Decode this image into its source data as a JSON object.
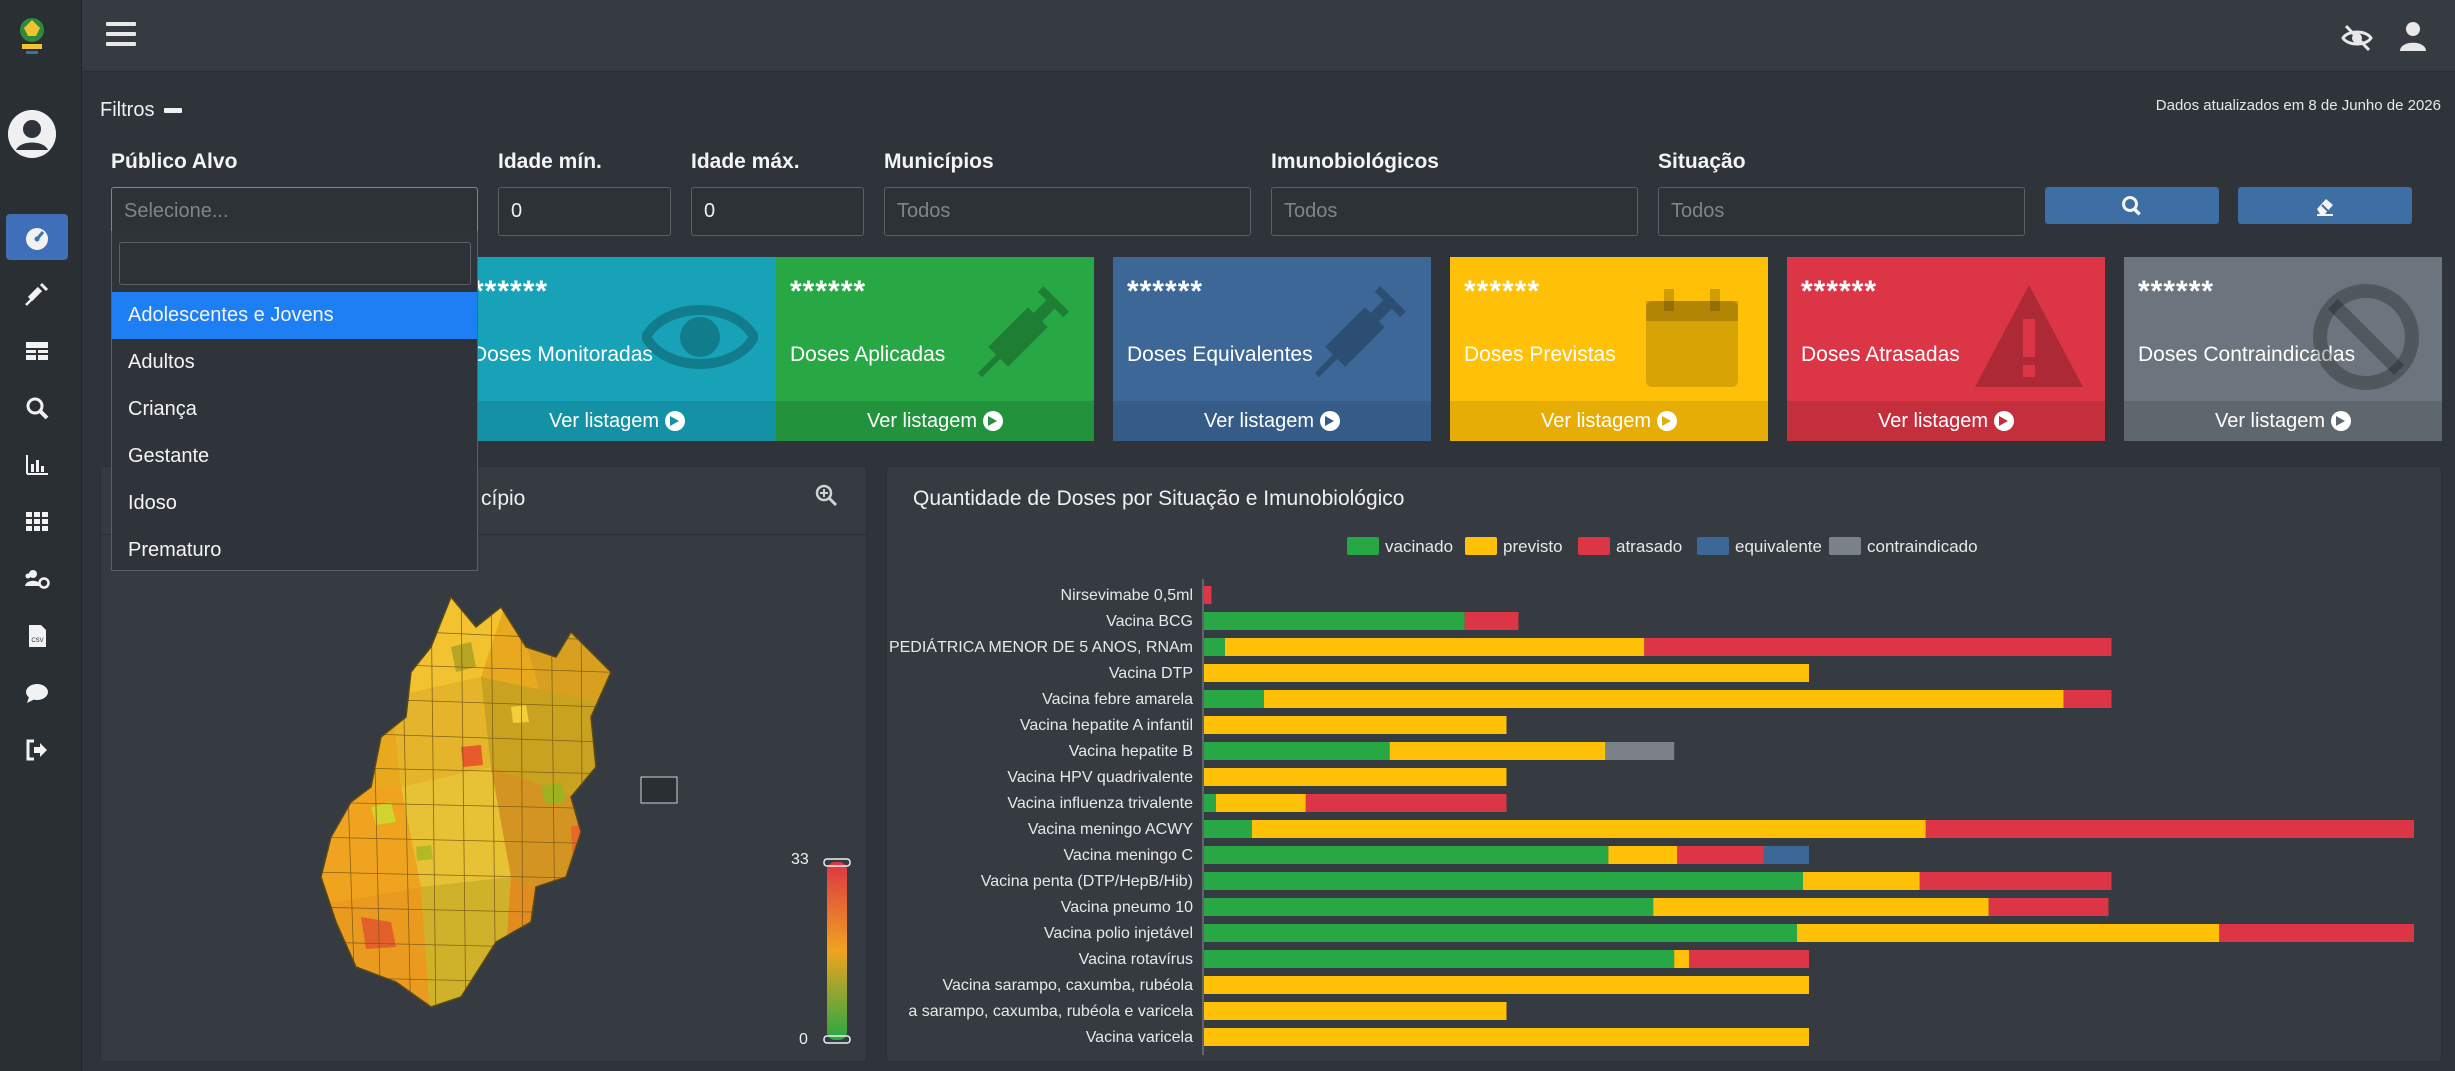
{
  "header": {
    "menu_icon": "hamburger-icon",
    "right_icons": [
      "eye-slash-icon",
      "user-icon"
    ]
  },
  "sidebar": {
    "items": [
      {
        "icon": "dashboard-icon",
        "active": true
      },
      {
        "icon": "syringe-icon"
      },
      {
        "icon": "table-icon"
      },
      {
        "icon": "search-icon"
      },
      {
        "icon": "bar-chart-icon"
      },
      {
        "icon": "grid-icon"
      },
      {
        "icon": "users-cog-icon"
      },
      {
        "icon": "csv-file-icon"
      },
      {
        "icon": "comment-icon"
      },
      {
        "icon": "sign-out-icon"
      }
    ]
  },
  "filters": {
    "title": "Filtros",
    "updated": "Dados atualizados em 8 de Junho de 2026",
    "publico_alvo": {
      "label": "Público Alvo",
      "placeholder": "Selecione..."
    },
    "idade_min": {
      "label": "Idade mín.",
      "value": "0"
    },
    "idade_max": {
      "label": "Idade máx.",
      "value": "0"
    },
    "municipios": {
      "label": "Municípios",
      "placeholder": "Todos"
    },
    "imunobiologicos": {
      "label": "Imunobiológicos",
      "placeholder": "Todos"
    },
    "situacao": {
      "label": "Situação",
      "placeholder": "Todos"
    },
    "search_button_icon": "search-icon",
    "clear_button_icon": "eraser-icon"
  },
  "dropdown": {
    "options": [
      "Adolescentes e Jovens",
      "Adultos",
      "Criança",
      "Gestante",
      "Idoso",
      "Prematuro"
    ],
    "highlighted": "Adolescentes e Jovens"
  },
  "cards": [
    {
      "value": "******",
      "label": "Doses Monitoradas",
      "link": "Ver listagem",
      "icon": "eye-icon",
      "color": "#17a2b8",
      "foot": "#1591a5"
    },
    {
      "value": "******",
      "label": "Doses Aplicadas",
      "link": "Ver listagem",
      "icon": "syringe-icon",
      "color": "#28a745",
      "foot": "#22923c"
    },
    {
      "value": "******",
      "label": "Doses Equivalentes",
      "link": "Ver listagem",
      "icon": "syringe-icon",
      "color": "#3c6797",
      "foot": "#355b87"
    },
    {
      "value": "******",
      "label": "Doses Previstas",
      "link": "Ver listagem",
      "icon": "calendar-icon",
      "color": "#ffc107",
      "foot": "#e6ad06"
    },
    {
      "value": "******",
      "label": "Doses Atrasadas",
      "link": "Ver listagem",
      "icon": "warning-icon",
      "color": "#dc3545",
      "foot": "#c42f3d"
    },
    {
      "value": "******",
      "label": "Doses Contraindicadas",
      "link": "Ver listagem",
      "icon": "ban-icon",
      "color": "#6c757d",
      "foot": "#5f676e"
    }
  ],
  "map_panel": {
    "title": "cípio",
    "zoom_icon": "zoom-in-icon",
    "scale_max": "33",
    "scale_min": "0"
  },
  "chart_panel": {
    "title": "Quantidade de Doses por Situação e Imunobiológico"
  },
  "chart_data": {
    "type": "bar",
    "orientation": "horizontal",
    "stacked": true,
    "legend_position": "top",
    "categories": [
      "Nirsevimabe 0,5ml",
      "Vacina BCG",
      "PEDIÁTRICA MENOR DE 5 ANOS, RNAm",
      "Vacina DTP",
      "Vacina febre amarela",
      "Vacina hepatite A infantil",
      "Vacina hepatite B",
      "Vacina HPV quadrivalente",
      "Vacina influenza trivalente",
      "Vacina meningo ACWY",
      "Vacina meningo C",
      "Vacina penta (DTP/HepB/Hib)",
      "Vacina pneumo 10",
      "Vacina polio injetável",
      "Vacina rotavírus",
      "Vacina sarampo, caxumba, rubéola",
      "a sarampo, caxumba, rubéola e varicela",
      "Vacina varicela"
    ],
    "series": [
      {
        "name": "vacinado",
        "color": "#28a745",
        "values": [
          0,
          8.7,
          0.7,
          0,
          2,
          0,
          6.2,
          0,
          0.4,
          1.6,
          13.5,
          20,
          15,
          19.8,
          15.7,
          0,
          0,
          0
        ]
      },
      {
        "name": "previsto",
        "color": "#ffc107",
        "values": [
          0,
          0,
          14,
          20.2,
          26.7,
          10.1,
          7.2,
          10.1,
          3,
          22.5,
          2.3,
          3.9,
          11.2,
          14.1,
          0.5,
          20.2,
          10.1,
          20.2
        ]
      },
      {
        "name": "atrasado",
        "color": "#dc3545",
        "values": [
          0.25,
          1.8,
          15.6,
          0,
          1.6,
          0,
          0,
          0,
          6.7,
          16.3,
          2.9,
          6.4,
          4,
          6.5,
          4,
          0,
          0,
          0
        ]
      },
      {
        "name": "equivalente",
        "color": "#3c6797",
        "values": [
          0,
          0,
          0,
          0,
          0,
          0,
          0,
          0,
          0,
          0,
          1.5,
          0,
          0,
          0,
          0,
          0,
          0,
          0
        ]
      },
      {
        "name": "contraindicado",
        "color": "#7a8288",
        "values": [
          0,
          0,
          0,
          0,
          0,
          0,
          2.3,
          0,
          0,
          0,
          0,
          0,
          0,
          0,
          0,
          0,
          0,
          0
        ]
      }
    ],
    "xlim": [
      0,
      40
    ]
  }
}
